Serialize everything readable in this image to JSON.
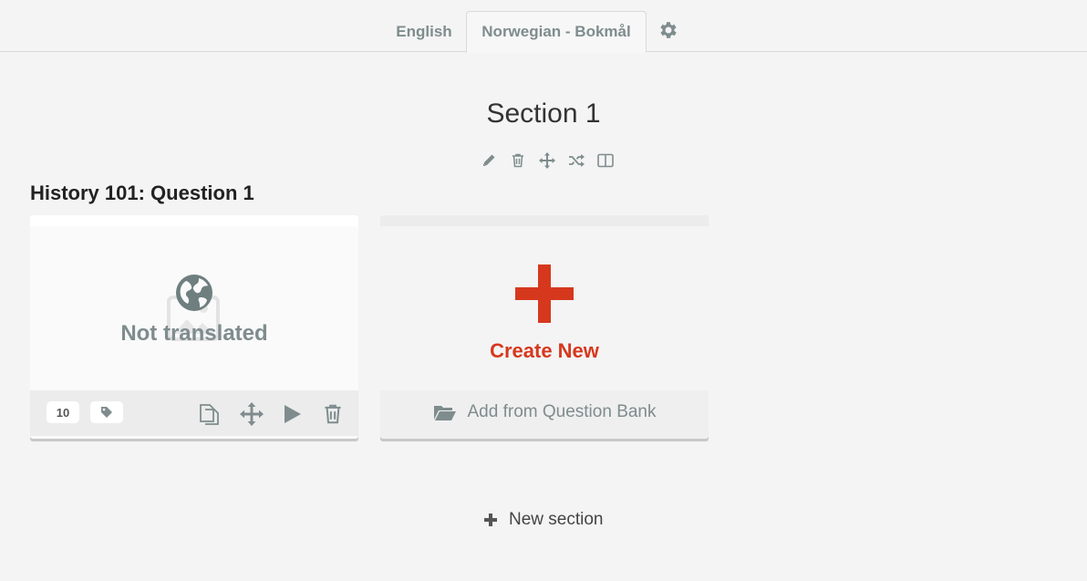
{
  "tabs": {
    "english": "English",
    "norwegian": "Norwegian - Bokmål",
    "settings_icon": "gear-icon"
  },
  "section": {
    "title": "Section 1",
    "tools": [
      "pencil-icon",
      "trash-icon",
      "move-icon",
      "shuffle-icon",
      "columns-icon"
    ]
  },
  "group": {
    "title": "History 101: Question 1"
  },
  "question_card": {
    "status": "Not translated",
    "points": "10",
    "tag_icon": "tag-icon",
    "actions": [
      "copy-icon",
      "move-icon",
      "play-icon",
      "trash-icon"
    ]
  },
  "create_card": {
    "label": "Create New",
    "bank_label": "Add from Question Bank",
    "bank_icon": "folder-open-icon"
  },
  "footer": {
    "new_section": "New section"
  },
  "colors": {
    "accent_red": "#d6381e",
    "muted": "#7f8c8d",
    "background": "#f4f4f4"
  }
}
